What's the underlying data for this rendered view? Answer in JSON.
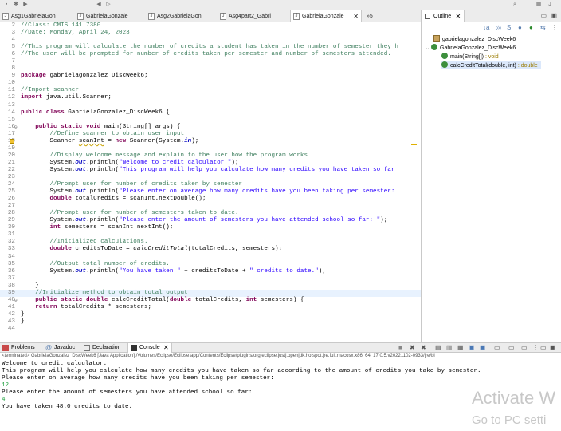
{
  "toolbar": {
    "icons": [
      "save-icon",
      "debug-icon",
      "run-icon",
      "search-icon",
      "perspective-icon"
    ]
  },
  "editor_tabs": [
    {
      "label": "Asg1GabrielaGon",
      "active": false
    },
    {
      "label": "GabrielaGonzale",
      "active": false
    },
    {
      "label": "Asg2GabrielaGon",
      "active": false
    },
    {
      "label": "Asg4part2_Gabri",
      "active": false
    },
    {
      "label": "GabrielaGonzale",
      "active": true
    }
  ],
  "editor_tab_overflow": "»5",
  "code_lines": [
    {
      "n": "2",
      "text": "//Class: CMIS 141 7380"
    },
    {
      "n": "3",
      "text": "//Date: Monday, April 24, 2023"
    },
    {
      "n": "4",
      "text": ""
    },
    {
      "n": "5",
      "text": "//This program will calculate the number of credits a student has taken in the number of semester they h"
    },
    {
      "n": "6",
      "text": "//The user will be prompted for number of credits taken per semester and number of semesters attended."
    },
    {
      "n": "7",
      "text": ""
    },
    {
      "n": "8",
      "text": ""
    },
    {
      "n": "9",
      "text": "package gabrielagonzalez_DiscWeek6;"
    },
    {
      "n": "10",
      "text": ""
    },
    {
      "n": "11",
      "text": "//Import scanner"
    },
    {
      "n": "12",
      "text": "import java.util.Scanner;"
    },
    {
      "n": "13",
      "text": ""
    },
    {
      "n": "14",
      "text": "public class GabrielaGonzalez_DiscWeek6 {"
    },
    {
      "n": "15",
      "text": ""
    },
    {
      "n": "16",
      "text": "    public static void main(String[] args) {"
    },
    {
      "n": "17",
      "text": "        //Define scanner to obtain user input"
    },
    {
      "n": "18",
      "text": "        Scanner scanInt = new Scanner(System.in);"
    },
    {
      "n": "19",
      "text": ""
    },
    {
      "n": "20",
      "text": "        //Display welcome message and explain to the user how the program works"
    },
    {
      "n": "21",
      "text": "        System.out.println(\"Welcome to credit calculator.\");"
    },
    {
      "n": "22",
      "text": "        System.out.println(\"This program will help you calculate how many credits you have taken so far"
    },
    {
      "n": "23",
      "text": ""
    },
    {
      "n": "24",
      "text": "        //Prompt user for number of credits taken by semester"
    },
    {
      "n": "25",
      "text": "        System.out.println(\"Please enter on average how many credits have you been taking per semester:"
    },
    {
      "n": "26",
      "text": "        double totalCredits = scanInt.nextDouble();"
    },
    {
      "n": "27",
      "text": ""
    },
    {
      "n": "28",
      "text": "        //Prompt user for number of semesters taken to date."
    },
    {
      "n": "29",
      "text": "        System.out.println(\"Please enter the amount of semesters you have attended school so far: \");"
    },
    {
      "n": "30",
      "text": "        int semesters = scanInt.nextInt();"
    },
    {
      "n": "31",
      "text": ""
    },
    {
      "n": "32",
      "text": "        //Initialized calculations."
    },
    {
      "n": "33",
      "text": "        double creditsToDate = calcCreditTotal(totalCredits, semesters);"
    },
    {
      "n": "34",
      "text": ""
    },
    {
      "n": "35",
      "text": "        //Output total number of credits."
    },
    {
      "n": "36",
      "text": "        System.out.println(\"You have taken \" + creditsToDate + \" credits to date.\");"
    },
    {
      "n": "37",
      "text": ""
    },
    {
      "n": "38",
      "text": "    }"
    },
    {
      "n": "39",
      "text": "    //Initialize method to obtain total output"
    },
    {
      "n": "40",
      "text": "    public static double calcCreditTotal(double totalCredits, int semesters) {"
    },
    {
      "n": "41",
      "text": "    return totalCredits * semesters;"
    },
    {
      "n": "42",
      "text": "}"
    },
    {
      "n": "43",
      "text": "}"
    },
    {
      "n": "44",
      "text": ""
    }
  ],
  "outline": {
    "tab_label": "Outline",
    "items": [
      {
        "label": "gabrielagonzalez_DiscWeek6",
        "detail": ""
      },
      {
        "label": "GabrielaGonzalez_DiscWeek6",
        "detail": ""
      },
      {
        "label": "main(String[])",
        "detail": " : void"
      },
      {
        "label": "calcCreditTotal(double, int)",
        "detail": " : double"
      }
    ]
  },
  "bottom_tabs": [
    {
      "label": "Problems",
      "active": false
    },
    {
      "label": "Javadoc",
      "active": false
    },
    {
      "label": "Declaration",
      "active": false
    },
    {
      "label": "Console",
      "active": true
    }
  ],
  "console": {
    "status": "<terminated> GabrielaGonzalez_DiscWeek6 [Java Application] /Volumes/Eclipse/Eclipse.app/Contents/Eclipse/plugins/org.eclipse.justj.openjdk.hotspot.jre.full.macosx.x86_64_17.0.5.v20221102-0933/jre/bi",
    "lines": [
      {
        "text": "Welcome to credit calculator.",
        "input": false
      },
      {
        "text": "This program will help you calculate how many credits you have taken so far according to the amount of credits you take by semester.",
        "input": false
      },
      {
        "text": "Please enter on average how many credits have you been taking per semester:",
        "input": false
      },
      {
        "text": "12",
        "input": true
      },
      {
        "text": "Please enter the amount of semesters you have attended school so far:",
        "input": false
      },
      {
        "text": "4",
        "input": true
      },
      {
        "text": "You have taken 48.0 credits to date.",
        "input": false
      }
    ]
  },
  "watermark": {
    "line1": "Activate W",
    "line2": "Go to PC setti"
  },
  "colors": {
    "keyword": "#7f0055",
    "comment": "#3f7f5f",
    "string": "#2a00ff",
    "field": "#0000c0",
    "console_input": "#1a9f3a"
  }
}
